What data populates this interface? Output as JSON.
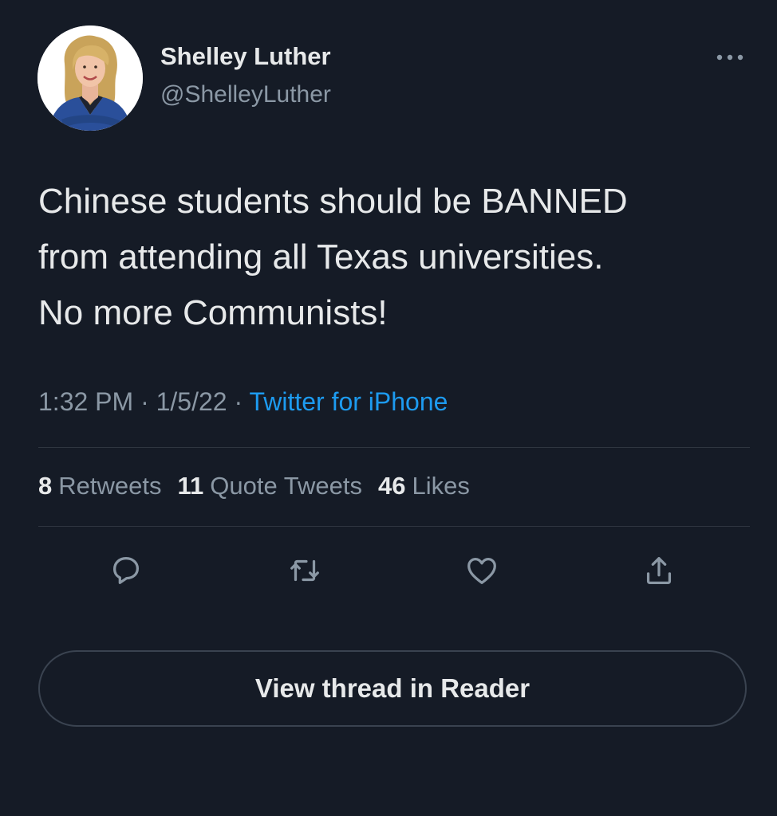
{
  "author": {
    "name": "Shelley Luther",
    "handle": "@ShelleyLuther",
    "avatar_icon": "profile-photo"
  },
  "tweet": {
    "lines": [
      "Chinese students should be BANNED",
      "from attending all Texas universities.",
      "No more Communists!"
    ],
    "time": "1:32 PM",
    "date": "1/5/22",
    "separator": "·",
    "source": "Twitter for iPhone"
  },
  "stats": {
    "retweets_count": "8",
    "retweets_label": "Retweets",
    "quotes_count": "11",
    "quotes_label": "Quote Tweets",
    "likes_count": "46",
    "likes_label": "Likes"
  },
  "actions": {
    "icons": [
      "reply-icon",
      "retweet-icon",
      "like-icon",
      "share-icon"
    ]
  },
  "reader_button": {
    "label": "View thread in Reader"
  },
  "colors": {
    "background": "#151b26",
    "text": "#e7e9ea",
    "secondary": "#8b98a5",
    "link": "#1d9bf0",
    "divider": "#2f3640"
  }
}
